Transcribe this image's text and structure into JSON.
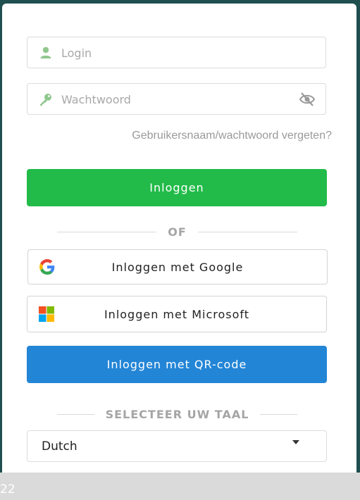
{
  "login_field": {
    "placeholder": "Login",
    "value": ""
  },
  "password_field": {
    "placeholder": "Wachtwoord",
    "value": ""
  },
  "forgot_link": "Gebruikersnaam/wachtwoord vergeten?",
  "login_button": "Inloggen",
  "or_divider": "OF",
  "google_button": "Inloggen met Google",
  "microsoft_button": "Inloggen met Microsoft",
  "qr_button": "Inloggen met QR-code",
  "language_heading": "SELECTEER UW TAAL",
  "language_select": {
    "selected": "Dutch"
  },
  "footer": {
    "text": "22"
  },
  "colors": {
    "primary_green": "#22bb49",
    "primary_blue": "#2385d6",
    "icon_green": "#8fc78f"
  },
  "icons": [
    "user-icon",
    "key-icon",
    "eye-slash-icon",
    "google-icon",
    "microsoft-icon",
    "chevron-down-icon"
  ]
}
